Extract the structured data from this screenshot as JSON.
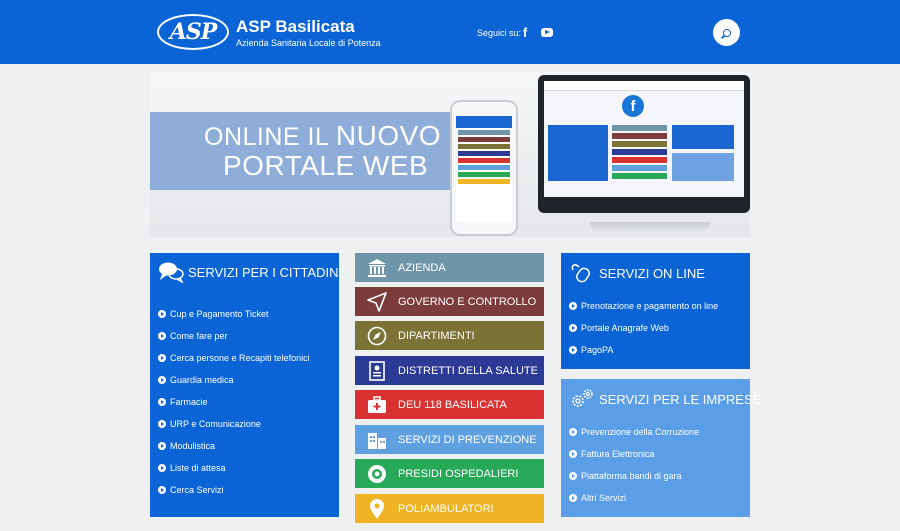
{
  "header": {
    "logo_text": "ASP",
    "title": "ASP Basilicata",
    "subtitle": "Azienda Sanitaria Locale di Potenza",
    "follow_label": "Seguici su:",
    "social": [
      {
        "icon": "facebook-icon",
        "glyph": "f"
      },
      {
        "icon": "youtube-icon"
      }
    ],
    "search_icon": "search-icon",
    "color": "#0a64d6"
  },
  "banner": {
    "line1_prefix": "ONLINE IL ",
    "line1_emphasis": "NUOVO",
    "line2": "PORTALE WEB"
  },
  "citizens": {
    "title": "SERVIZI PER I CITTADINI",
    "icon": "speech-bubbles-icon",
    "items": [
      "Cup e Pagamento Ticket",
      "Come fare per",
      "Cerca persone e Recapiti telefonici",
      "Guardia medica",
      "Farmacie",
      "URP e Comunicazione",
      "Modulistica",
      "Liste di attesa",
      "Cerca Servizi"
    ]
  },
  "tiles": [
    {
      "label": "AZIENDA",
      "color": "#6f95a8",
      "icon": "building-columns-icon"
    },
    {
      "label": "GOVERNO E CONTROLLO",
      "color": "#7d3c3c",
      "icon": "navigation-arrow-icon"
    },
    {
      "label": "DIPARTIMENTI",
      "color": "#7b7235",
      "icon": "compass-icon"
    },
    {
      "label": "DISTRETTI DELLA SALUTE",
      "color": "#2b3a94",
      "icon": "id-card-icon"
    },
    {
      "label": "DEU 118 BASILICATA",
      "color": "#d93232",
      "icon": "first-aid-kit-icon"
    },
    {
      "label": "SERVIZI DI PREVENZIONE",
      "color": "#5ea0e0",
      "icon": "city-buildings-icon"
    },
    {
      "label": "PRESIDI OSPEDALIERI",
      "color": "#27a957",
      "icon": "target-circle-icon"
    },
    {
      "label": "POLIAMBULATORI",
      "color": "#f0b324",
      "icon": "map-pin-icon"
    }
  ],
  "online": {
    "title": "SERVIZI ON LINE",
    "icon": "computer-mouse-icon",
    "items": [
      "Prenotazione e pagamento on line",
      "Portale Anagrafe Web",
      "PagoPA"
    ]
  },
  "business": {
    "title": "SERVIZI PER LE IMPRESE",
    "icon": "gears-icon",
    "items": [
      "Prevenzione della Corruzione",
      "Fattura Elettronica",
      "Piattaforma bandi di gara",
      "Altri Servizi"
    ]
  }
}
